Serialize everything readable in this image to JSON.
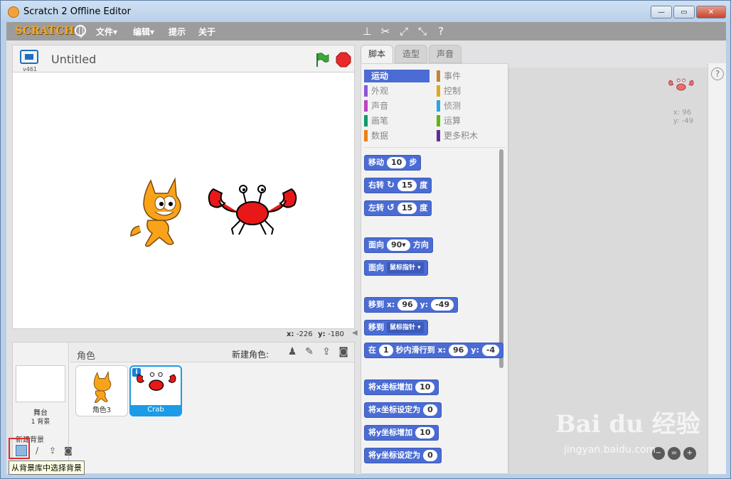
{
  "window": {
    "title": "Scratch 2 Offline Editor",
    "minimize": "—",
    "maximize": "▭",
    "close": "✕"
  },
  "menubar": {
    "logo": "SCRATCH",
    "file": "文件▾",
    "edit": "编辑▾",
    "tips": "提示",
    "about": "关于"
  },
  "stage": {
    "version": "v461",
    "project_title": "Untitled",
    "mouse_x_label": "x:",
    "mouse_x": "-226",
    "mouse_y_label": "y:",
    "mouse_y": "-180"
  },
  "sprite_pane": {
    "sprites_label": "角色",
    "new_sprite_label": "新建角色:",
    "stage_name": "舞台",
    "bg_count": "1 背景",
    "new_bg_label": "新建背景",
    "tooltip": "从背景库中选择背景",
    "sprites": [
      {
        "name": "角色3"
      },
      {
        "name": "Crab",
        "selected": true
      }
    ]
  },
  "tabs": [
    {
      "label": "脚本",
      "active": true
    },
    {
      "label": "造型"
    },
    {
      "label": "声音"
    }
  ],
  "categories": [
    {
      "label": "运动",
      "color": "#4a6cd4",
      "active": true
    },
    {
      "label": "事件",
      "color": "#c88330"
    },
    {
      "label": "外观",
      "color": "#8a55d7"
    },
    {
      "label": "控制",
      "color": "#e1a91a"
    },
    {
      "label": "声音",
      "color": "#bb42c3"
    },
    {
      "label": "侦测",
      "color": "#2ca5e2"
    },
    {
      "label": "画笔",
      "color": "#0e9a6c"
    },
    {
      "label": "运算",
      "color": "#5cb712"
    },
    {
      "label": "数据",
      "color": "#ee7d16"
    },
    {
      "label": "更多积木",
      "color": "#632d99"
    }
  ],
  "blocks": {
    "move": {
      "a": "移动",
      "n": "10",
      "b": "步"
    },
    "turn_right": {
      "a": "右转",
      "n": "15",
      "b": "度"
    },
    "turn_left": {
      "a": "左转",
      "n": "15",
      "b": "度"
    },
    "point_dir": {
      "a": "面向",
      "n": "90▾",
      "b": "方向"
    },
    "point_towards": {
      "a": "面向",
      "d": "鼠标指针 ▾"
    },
    "goto_xy": {
      "a": "移到 x:",
      "x": "96",
      "b": "y:",
      "y": "-49"
    },
    "goto": {
      "a": "移到",
      "d": "鼠标指针 ▾"
    },
    "glide": {
      "a": "在",
      "n": "1",
      "b": "秒内滑行到 x:",
      "x": "96",
      "c": "y:",
      "y": "-4"
    },
    "change_x": {
      "a": "将x坐标增加",
      "n": "10"
    },
    "set_x": {
      "a": "将x坐标设定为",
      "n": "0"
    },
    "change_y": {
      "a": "将y坐标增加",
      "n": "10"
    },
    "set_y": {
      "a": "将y坐标设定为",
      "n": "0"
    }
  },
  "scripts_area": {
    "x_label": "x: 96",
    "y_label": "y: -49",
    "zoom_out": "−",
    "zoom_reset": "=",
    "zoom_in": "+"
  },
  "watermark": {
    "brand": "Bai du 经验",
    "url": "jingyan.baidu.com"
  }
}
